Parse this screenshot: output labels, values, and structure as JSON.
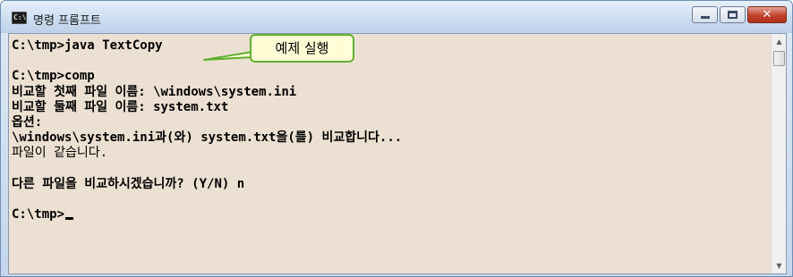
{
  "window": {
    "icon_text": "C:\\",
    "title": "명령 프롬프트",
    "buttons": {
      "minimize": "minimize",
      "maximize": "maximize",
      "close": "✕"
    }
  },
  "console": {
    "lines": [
      "C:\\tmp>java TextCopy",
      "",
      "C:\\tmp>comp",
      "비교할 첫째 파일 이름: \\windows\\system.ini",
      "비교할 둘째 파일 이름: system.txt",
      "옵션:",
      "\\windows\\system.ini과(와) system.txt을(를) 비교합니다...",
      "파일이 같습니다.",
      "",
      "다른 파일을 비교하시겠습니까? (Y/N) n",
      "",
      "C:\\tmp>"
    ]
  },
  "callout": {
    "text": "예제 실행"
  },
  "scrollbar": {
    "up": "▲",
    "down": "▼"
  }
}
